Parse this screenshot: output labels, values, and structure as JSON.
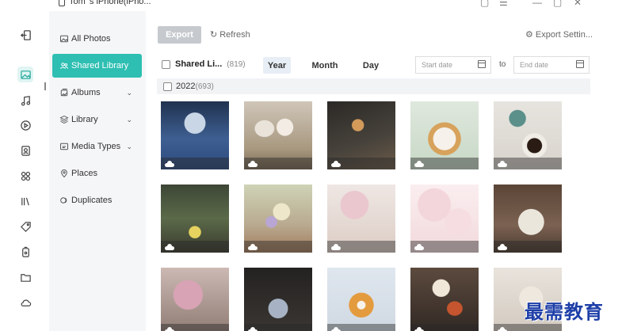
{
  "titlebar": {
    "device_name": "Tom    's iPhone(iPho..."
  },
  "sidebar": {
    "items": [
      {
        "label": "All Photos",
        "icon": "photos-icon"
      },
      {
        "label": "Shared Library",
        "icon": "people-icon"
      },
      {
        "label": "Albums",
        "icon": "albums-icon"
      },
      {
        "label": "Library",
        "icon": "layers-icon"
      },
      {
        "label": "Media Types",
        "icon": "media-types-icon"
      },
      {
        "label": "Places",
        "icon": "place-pin-icon"
      },
      {
        "label": "Duplicates",
        "icon": "duplicates-icon"
      }
    ]
  },
  "toolbar": {
    "export_label": "Export",
    "refresh_label": "Refresh",
    "export_settings_label": "Export Settin..."
  },
  "filter": {
    "album_name": "Shared Li...",
    "album_count": "(819)",
    "year_label": "Year",
    "month_label": "Month",
    "day_label": "Day",
    "start_date_placeholder": "Start date",
    "to_label": "to",
    "end_date_placeholder": "End date"
  },
  "group": {
    "year": "2022",
    "count": "(693)"
  },
  "watermark": "最需教育",
  "colors": {
    "accent": "#2ebfb2",
    "export_disabled": "#c6cace",
    "sidebar_bg": "#f5f6f8"
  }
}
